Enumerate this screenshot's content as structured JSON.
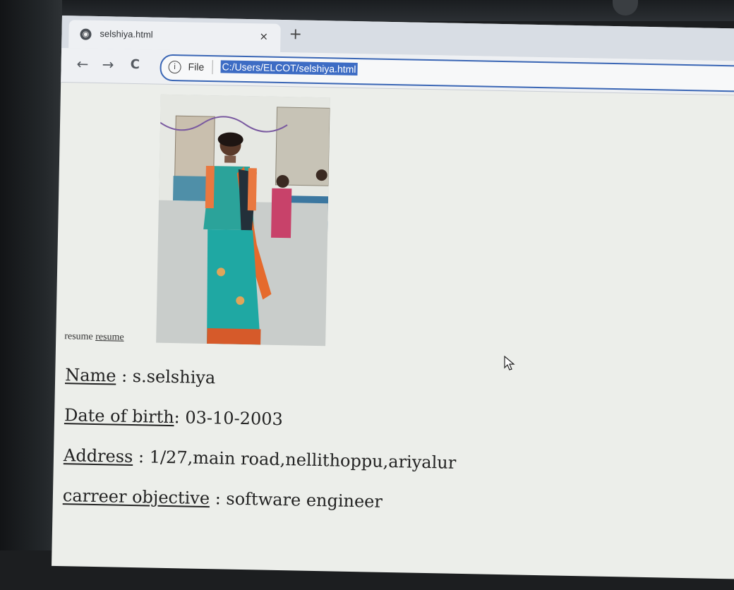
{
  "browser": {
    "tab_title": "selshiya.html",
    "tab_close": "×",
    "new_tab": "+",
    "back": "←",
    "forward": "→",
    "reload": "C",
    "info_icon": "i",
    "scheme_label": "File",
    "url": "C:/Users/ELCOT/selshiya.html"
  },
  "page": {
    "broken_image_text": "resume",
    "broken_image_link": "resume",
    "fields": [
      {
        "label": "Name",
        "value": " : s.selshiya"
      },
      {
        "label": "Date of birth",
        "value": ": 03-10-2003"
      },
      {
        "label": "Address",
        "value": " : 1/27,main road,nellithoppu,ariyalur"
      },
      {
        "label": "carreer objective",
        "value": " : software engineer"
      }
    ]
  }
}
